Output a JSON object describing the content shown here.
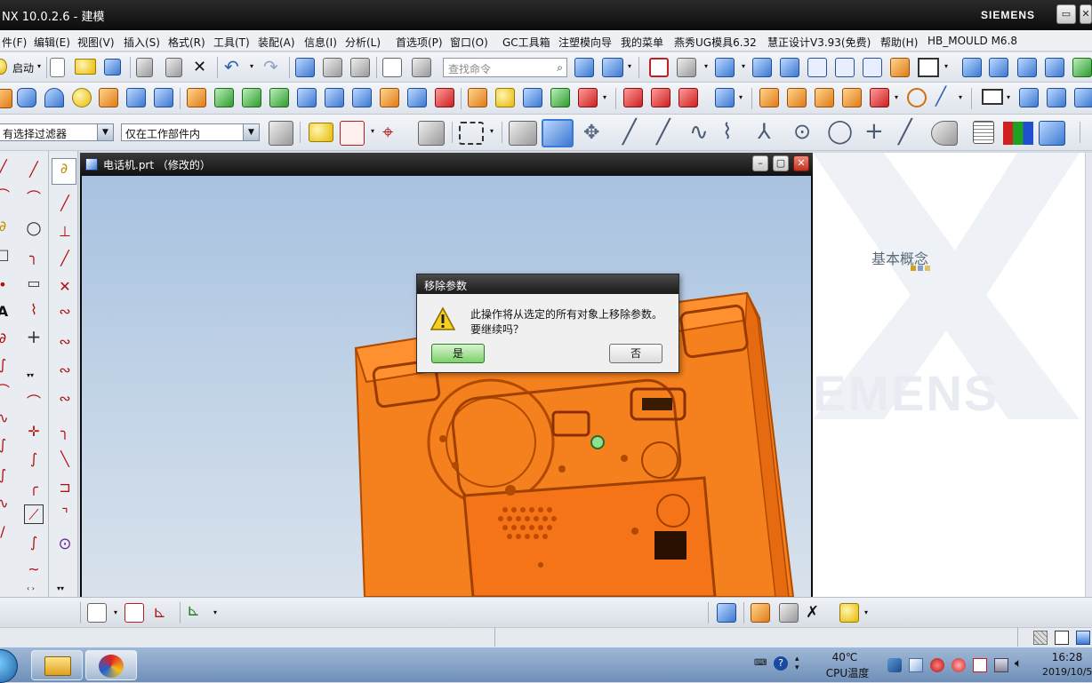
{
  "titlebar": {
    "title": "NX 10.0.2.6 - 建模",
    "brand": "SIEMENS",
    "buttons": [
      "restore",
      "close"
    ]
  },
  "menubar": {
    "items": [
      "件(F)",
      "编辑(E)",
      "视图(V)",
      "插入(S)",
      "格式(R)",
      "工具(T)",
      "装配(A)",
      "信息(I)",
      "分析(L)",
      "首选项(P)",
      "窗口(O)",
      "GC工具箱",
      "注塑模向导",
      "我的菜单",
      "燕秀UG模具6.32",
      "慧正设计V3.93(免费)",
      "帮助(H)",
      "HB_MOULD M6.8"
    ]
  },
  "toolbar1": {
    "start_label": "启动",
    "search_placeholder": "查找命令"
  },
  "toolbar3": {
    "filter_value": "有选择过滤器",
    "scope_value": "仅在工作部件内"
  },
  "document": {
    "title": "电话机.prt （修改的）"
  },
  "dialog": {
    "title": "移除参数",
    "message_line1": "此操作将从选定的所有对象上移除参数。",
    "message_line2": "要继续吗？",
    "yes_label": "是",
    "no_label": "否"
  },
  "rightpanel": {
    "caption": "基本概念",
    "watermark": "EMENS"
  },
  "taskbar": {
    "temperature": "40℃",
    "temperature_label": "CPU温度",
    "time": "16:28",
    "date": "2019/10/5"
  },
  "colors": {
    "part_orange": "#f5801e",
    "part_dark": "#b04a00",
    "viewport_top": "#a8c2e0",
    "titlebar": "#111111"
  }
}
